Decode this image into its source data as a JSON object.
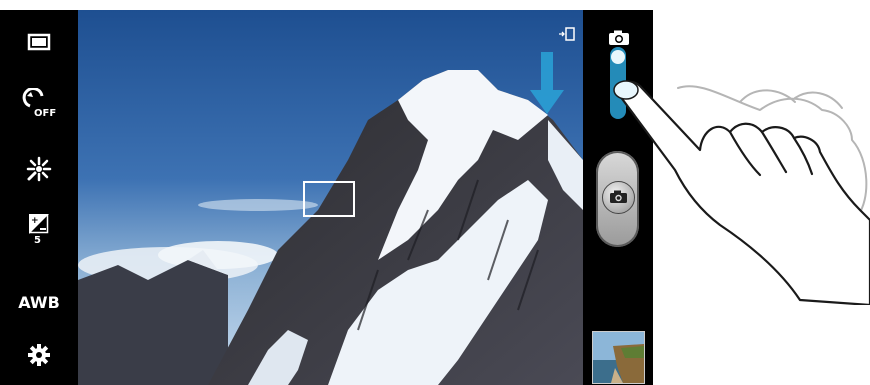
{
  "left_toolbar": {
    "items": [
      {
        "name": "shooting-mode",
        "icon": "single-shot-icon"
      },
      {
        "name": "timer",
        "icon": "timer-off-icon",
        "label": "OFF"
      },
      {
        "name": "effects",
        "icon": "sparkle-icon"
      },
      {
        "name": "exposure",
        "icon": "exposure-value-icon",
        "value": "5"
      },
      {
        "name": "white-balance",
        "icon": "awb-icon",
        "label": "AWB"
      },
      {
        "name": "settings",
        "icon": "gear-icon"
      }
    ]
  },
  "viewfinder": {
    "focus_box": true,
    "switch_camera_icon": "switch-camera-icon"
  },
  "right_bar": {
    "mode_icon": "camera-icon",
    "shutter_icon": "camera-icon",
    "thumbnail": "last-photo-thumbnail"
  },
  "colors": {
    "accent_blue": "#2aa3d8",
    "sky": "#2d5fa0",
    "bar": "#000000"
  }
}
